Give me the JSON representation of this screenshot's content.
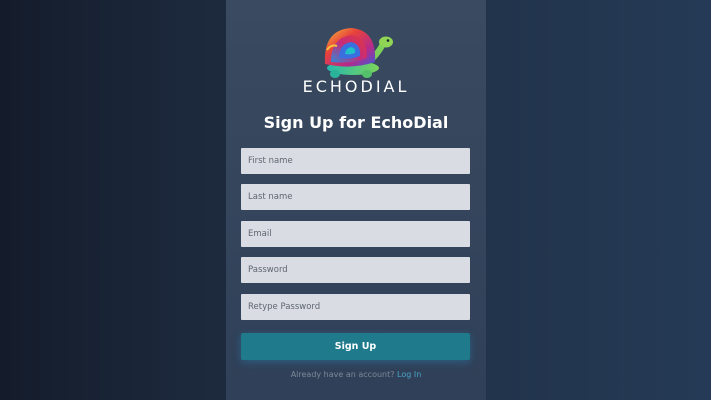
{
  "brand": {
    "name": "ECHODIAL",
    "logo_icon": "turtle-logo-icon"
  },
  "page": {
    "title": "Sign Up for EchoDial"
  },
  "form": {
    "first_name_placeholder": "First name",
    "last_name_placeholder": "Last name",
    "email_placeholder": "Email",
    "password_placeholder": "Password",
    "retype_password_placeholder": "Retype Password",
    "submit_label": "Sign Up"
  },
  "footer": {
    "prompt": "Already have an account?",
    "login_label": "Log In"
  },
  "colors": {
    "accent": "#1f7a8c",
    "link": "#4aa3c9",
    "field_bg": "#d9dce2"
  }
}
